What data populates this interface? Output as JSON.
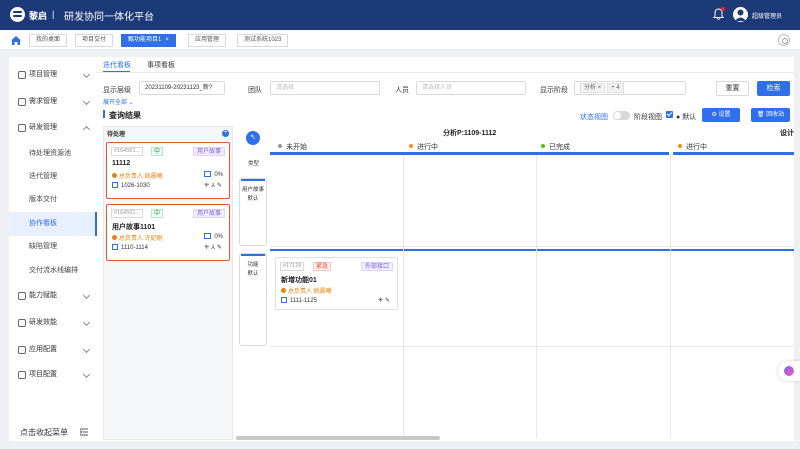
{
  "header": {
    "brand": "黎启",
    "title": "研发协同一体化平台",
    "user": "超级管理员"
  },
  "page_tabs": [
    {
      "label": "我的桌面"
    },
    {
      "label": "项目交付"
    },
    {
      "label": "甄功能项目1"
    },
    {
      "label": "应用管理"
    },
    {
      "label": "测试系统1023"
    }
  ],
  "sidebar": {
    "items": [
      {
        "label": "项目管理"
      },
      {
        "label": "需求管理"
      },
      {
        "label": "研发管理"
      },
      {
        "label": "能力赋能"
      },
      {
        "label": "研发效能"
      },
      {
        "label": "应用配置"
      },
      {
        "label": "项目配置"
      }
    ],
    "sub_items": [
      {
        "label": "待处理资源池"
      },
      {
        "label": "迭代管理"
      },
      {
        "label": "版本交付"
      },
      {
        "label": "协作看板"
      },
      {
        "label": "缺陷管理"
      },
      {
        "label": "交付流水线编排"
      }
    ],
    "collapse_label": "点击收起菜单"
  },
  "view_tabs": {
    "iteration": "迭代看板",
    "matter": "事项看板"
  },
  "filters": {
    "display_level_label": "显示层级",
    "display_level_value": "20231109-20231123_新?",
    "team_label": "团队",
    "team_placeholder": "请选择",
    "person_label": "人员",
    "person_placeholder": "请选择人员",
    "stage_label": "显示阶段",
    "stage_tag": "分析",
    "stage_more": "+ 4",
    "reset": "重置",
    "search": "检索",
    "expand": "展开全部"
  },
  "results": {
    "title": "查询结果",
    "status_view": "状态视图",
    "stage_view": "阶段视图",
    "default": "默认",
    "settings": "设置",
    "recycle": "回收站"
  },
  "pending": {
    "title": "待处理",
    "cards": [
      {
        "id": "#164561...",
        "priority": "中",
        "type": "用户故事",
        "title": "11112",
        "owner": "总负责人:姚晨曦",
        "date": "1026-1030",
        "progress": "0%"
      },
      {
        "id": "#164561...",
        "priority": "中",
        "type": "用户故事",
        "title": "用户故事1101",
        "owner": "总负责人:许纪刚",
        "date": "1110-1114",
        "progress": "0%"
      }
    ]
  },
  "kanban": {
    "type_label": "类型",
    "lanes": [
      {
        "line1": "用户故事",
        "line2": "默认"
      },
      {
        "line1": "功能",
        "line2": "默认"
      }
    ],
    "stages": [
      {
        "title": "分析P:1109-1112"
      },
      {
        "title": "设计"
      }
    ],
    "statuses": [
      {
        "label": "未开始",
        "color": "#999999"
      },
      {
        "label": "进行中",
        "color": "#fa8c16"
      },
      {
        "label": "已完成",
        "color": "#52c41a"
      },
      {
        "label": "进行中",
        "color": "#fa8c16"
      }
    ],
    "card": {
      "id": "#17129",
      "priority": "紧急",
      "type": "外部接口",
      "title": "新增功能01",
      "owner": "总负责人:姚晨曦",
      "date": "1111-1125"
    }
  }
}
